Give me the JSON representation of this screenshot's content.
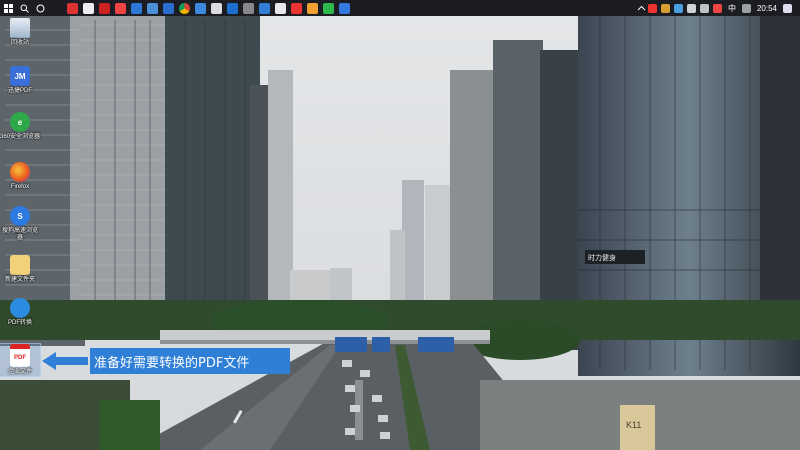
{
  "taskbar": {
    "ime_label": "中",
    "time": "20:54",
    "apps": [
      "search-icon",
      "task-view-icon",
      "netease-icon",
      "app-icon",
      "app-icon",
      "app-icon",
      "app-icon",
      "chrome-icon",
      "app-icon",
      "app-icon",
      "app-icon",
      "app-icon",
      "app-icon",
      "app-icon",
      "app-icon",
      "app-icon",
      "wechat-icon",
      "app-icon"
    ]
  },
  "desktop": {
    "icons": [
      {
        "name": "recycle-bin-icon",
        "label": "回收站"
      },
      {
        "name": "jm-icon",
        "label": "迅捷PDF"
      },
      {
        "name": "browser-icon",
        "label": "360安全浏览器"
      },
      {
        "name": "firefox-icon",
        "label": "Firefox"
      },
      {
        "name": "sogou-icon",
        "label": "搜狗高速浏览器"
      },
      {
        "name": "folder-icon",
        "label": "新建文件夹"
      },
      {
        "name": "pdf-converter-icon",
        "label": "PDF转换"
      },
      {
        "name": "pdf-file-icon",
        "label": "企业文件"
      }
    ]
  },
  "annotation": {
    "text": "准备好需要转换的PDF文件",
    "color": "#2f7fd6"
  },
  "wallpaper": {
    "sign_text": "时力健身",
    "marker_text": "K11"
  }
}
